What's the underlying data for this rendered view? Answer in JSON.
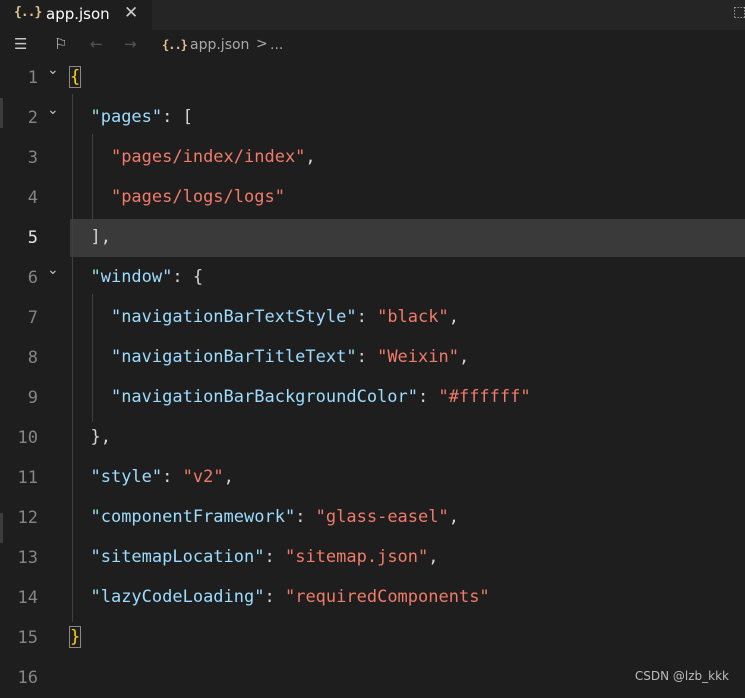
{
  "tab": {
    "icon": "{..}",
    "label": "app.json",
    "close_icon": "close-icon"
  },
  "toolbar": {
    "crumb_icon": "{..}",
    "crumb_file": "app.json",
    "crumb_sep": ">",
    "crumb_more": "..."
  },
  "editor": {
    "active_line": 5,
    "lines": [
      {
        "n": "1"
      },
      {
        "n": "2"
      },
      {
        "n": "3"
      },
      {
        "n": "4"
      },
      {
        "n": "5"
      },
      {
        "n": "6"
      },
      {
        "n": "7"
      },
      {
        "n": "8"
      },
      {
        "n": "9"
      },
      {
        "n": "10"
      },
      {
        "n": "11"
      },
      {
        "n": "12"
      },
      {
        "n": "13"
      },
      {
        "n": "14"
      },
      {
        "n": "15"
      },
      {
        "n": "16"
      }
    ],
    "code": {
      "l1": "{",
      "l2_key": "\"pages\"",
      "l2_rest": ": [",
      "l3_val": "\"pages/index/index\"",
      "l3_rest": ",",
      "l4_val": "\"pages/logs/logs\"",
      "l5": "],",
      "l6_key": "\"window\"",
      "l6_rest": ": {",
      "l7_key": "\"navigationBarTextStyle\"",
      "l7_mid": ": ",
      "l7_val": "\"black\"",
      "l7_rest": ",",
      "l8_key": "\"navigationBarTitleText\"",
      "l8_mid": ": ",
      "l8_val": "\"Weixin\"",
      "l8_rest": ",",
      "l9_key": "\"navigationBarBackgroundColor\"",
      "l9_mid": ": ",
      "l9_val": "\"#ffffff\"",
      "l10": "},",
      "l11_key": "\"style\"",
      "l11_mid": ": ",
      "l11_val": "\"v2\"",
      "l11_rest": ",",
      "l12_key": "\"componentFramework\"",
      "l12_mid": ": ",
      "l12_val": "\"glass-easel\"",
      "l12_rest": ",",
      "l13_key": "\"sitemapLocation\"",
      "l13_mid": ": ",
      "l13_val": "\"sitemap.json\"",
      "l13_rest": ",",
      "l14_key": "\"lazyCodeLoading\"",
      "l14_mid": ": ",
      "l14_val": "\"requiredComponents\"",
      "l15": "}"
    }
  },
  "watermark": "CSDN @lzb_kkk",
  "colors": {
    "key": "#9cdcfe",
    "string": "#f17b6a",
    "bracket": "#ffd700",
    "background": "#1e1e1e"
  }
}
